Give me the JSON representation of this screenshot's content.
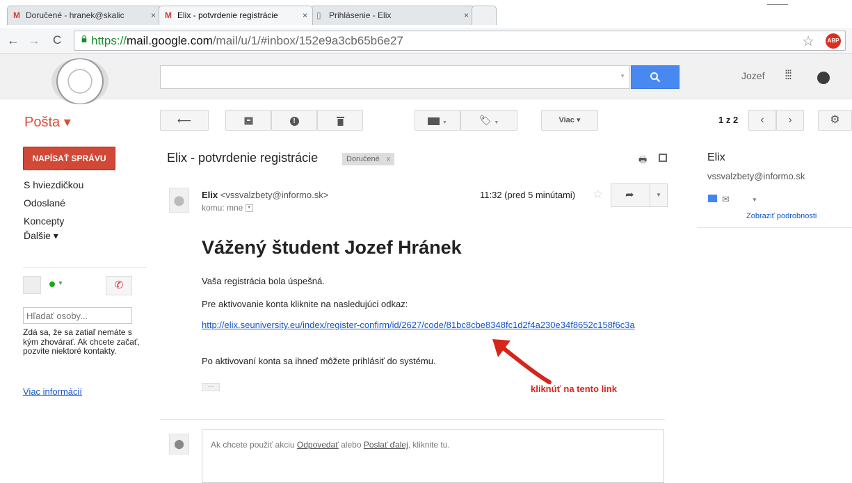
{
  "browser": {
    "tabs": [
      {
        "icon": "M",
        "title": "Doručené - hranek@skalic",
        "close": "×"
      },
      {
        "icon": "M",
        "title": "Elix - potvrdenie registrácie",
        "close": "×"
      },
      {
        "icon": "▯",
        "title": "Prihlásenie - Elix",
        "close": "×"
      }
    ],
    "url_scheme": "https://",
    "url_host": "mail.google.com",
    "url_path": "/mail/u/1/#inbox/152e9a3cb65b6e27",
    "adblock_label": "ABP"
  },
  "gmail": {
    "user_name": "Jozef",
    "mail_label": "Pošta ▾",
    "more_label": "Viac ▾",
    "page_count": "1 z 2",
    "compose_label": "NAPÍSAŤ SPRÁVU",
    "folders": [
      "Doručené",
      "S hviezdičkou",
      "Odoslané",
      "Koncepty",
      "Ďalšie ▾"
    ],
    "people_placeholder": "Hľadať osoby...",
    "hangouts_text": "Zdá sa, že sa zatiaľ nemáte s kým zhovárať. Ak chcete začať, pozvite niektoré kontakty.",
    "more_info_link": "Viac informácií"
  },
  "message": {
    "subject": "Elix - potvrdenie registrácie",
    "label_chip": "Doručené",
    "label_chip_close": "x",
    "sender_name": "Elix",
    "sender_email": "<vssvalzbety@informo.sk>",
    "to_line": "komu: mne",
    "time": "11:32 (pred 5 minútami)",
    "greeting": "Vážený študent Jozef Hránek",
    "line1": "Vaša registrácia bola úspešná.",
    "line2": "Pre aktivovanie konta kliknite na nasledujúci odkaz:",
    "activation_link": "http://elix.seuniversity.eu/index/register-confirm/id/2627/code/81bc8cbe8348fc1d2f4a230e34f8652c158f6c3a",
    "line3": "Po aktivovaní konta sa ihneď môžete prihlásiť do systému.",
    "trimmed": "···",
    "annotation": "kliknúť na tento link",
    "reply_prompt_prefix": "Ak chcete použiť akciu ",
    "reply_word": "Odpovedať",
    "reply_mid": " alebo ",
    "forward_word": "Poslať ďalej",
    "reply_prompt_suffix": ", kliknite tu."
  },
  "contact": {
    "name": "Elix",
    "email": "vssvalzbety@informo.sk",
    "details_link": "Zobraziť podrobnosti"
  },
  "colors": {
    "compose_red": "#d14836",
    "link_blue": "#1155cc",
    "search_blue": "#4889f1",
    "annotation_red": "#d5261b"
  }
}
